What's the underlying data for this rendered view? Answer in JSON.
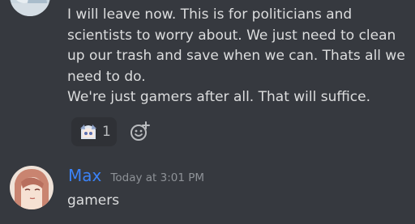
{
  "messages": [
    {
      "lines": [
        "I will leave now. This is for politicians and",
        "scientists to worry about. We just need to clean",
        "up our trash and save when we can. Thats all we",
        "need to do.",
        "We're just gamers after all. That will suffice."
      ],
      "reaction": {
        "icon": "anime-character-emoji-icon",
        "count": "1"
      },
      "add_reaction_icon": "add-reaction-icon"
    },
    {
      "author": "Max",
      "timestamp": "Today at 3:01 PM",
      "lines": [
        "gamers"
      ]
    }
  ],
  "colors": {
    "background": "#36393f",
    "text": "#dcddde",
    "author_max": "#3b82f6",
    "timestamp": "#8e9297",
    "reaction_bg": "#2f3136"
  }
}
